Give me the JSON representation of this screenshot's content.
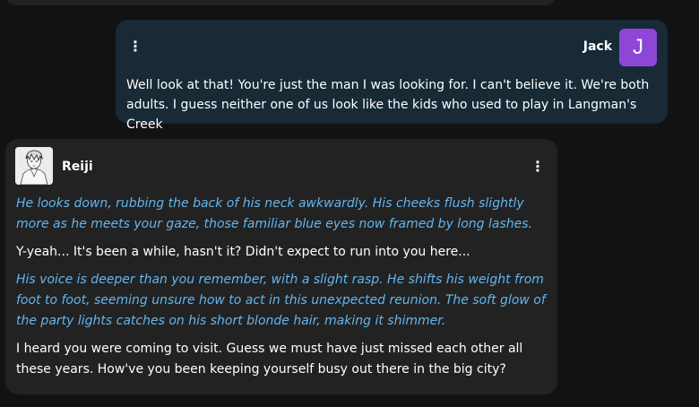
{
  "previous_message": {},
  "user_message": {
    "sender": "Jack",
    "avatar_letter": "J",
    "avatar_color": "#8e46d6",
    "text": "Well look at that! You're just the man I was looking for. I can't believe it. We're both adults. I guess neither one of us look like the kids who used to play in Langman's Creek"
  },
  "bot_message": {
    "sender": "Reiji",
    "avatar_icon": "character-portrait-icon",
    "paragraphs": [
      {
        "style": "narration",
        "text": "He looks down, rubbing the back of his neck awkwardly. His cheeks flush slightly more as he meets your gaze, those familiar blue eyes now framed by long lashes."
      },
      {
        "style": "speech",
        "text": "Y-yeah... It's been a while, hasn't it? Didn't expect to run into you here..."
      },
      {
        "style": "narration",
        "text": "His voice is deeper than you remember, with a slight rasp. He shifts his weight from foot to foot, seeming unsure how to act in this unexpected reunion. The soft glow of the party lights catches on his short blonde hair, making it shimmer."
      },
      {
        "style": "speech",
        "text": "I heard you were coming to visit. Guess we must have just missed each other all these years. How've you been keeping yourself busy out there in the big city?"
      }
    ]
  },
  "colors": {
    "background": "#121212",
    "user_bubble": "#172a36",
    "bot_bubble": "#222222",
    "narration_text": "#62b6f0",
    "speech_text": "#ffffff"
  },
  "icons": {
    "message_menu": "more-vertical-icon"
  }
}
